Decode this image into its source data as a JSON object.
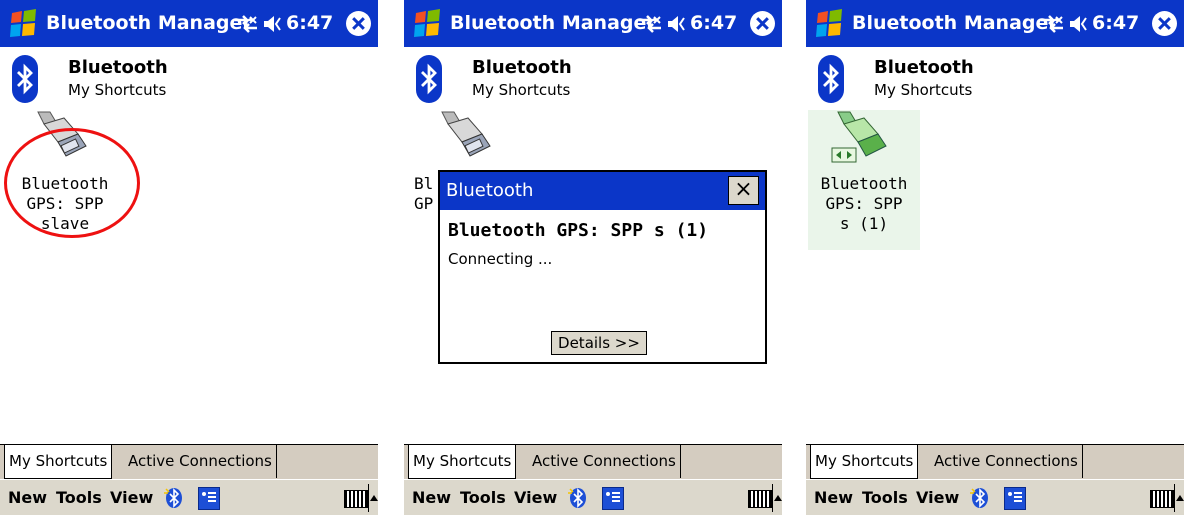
{
  "titlebar": {
    "title": "Bluetooth Manager",
    "time": "6:47"
  },
  "app": {
    "title": "Bluetooth",
    "subtitle": "My Shortcuts"
  },
  "screens": [
    {
      "shortcut_label": "Bluetooth\nGPS: SPP\nslave"
    },
    {
      "shortcut_label": "Bl\nGP"
    },
    {
      "shortcut_label": "Bluetooth\nGPS: SPP\ns (1)"
    }
  ],
  "dialog": {
    "title": "Bluetooth",
    "close": "×",
    "heading": "Bluetooth GPS: SPP s (1)",
    "status": "Connecting ...",
    "details_button": "Details >>"
  },
  "tabs": {
    "my_shortcuts": "My Shortcuts",
    "active_connections": "Active Connections"
  },
  "menubar": {
    "new": "New",
    "tools": "Tools",
    "view": "View"
  },
  "colors": {
    "titlebar": "#0b36c8",
    "highlight_circle": "#e11111",
    "tab_bar": "#d4ccc0"
  },
  "icons": [
    "windows-start-icon",
    "connectivity-icon",
    "volume-icon",
    "close-icon",
    "bluetooth-logo-icon",
    "serial-plug-icon",
    "bluetooth-icon",
    "contacts-icon",
    "keyboard-icon",
    "sip-arrow-icon"
  ]
}
